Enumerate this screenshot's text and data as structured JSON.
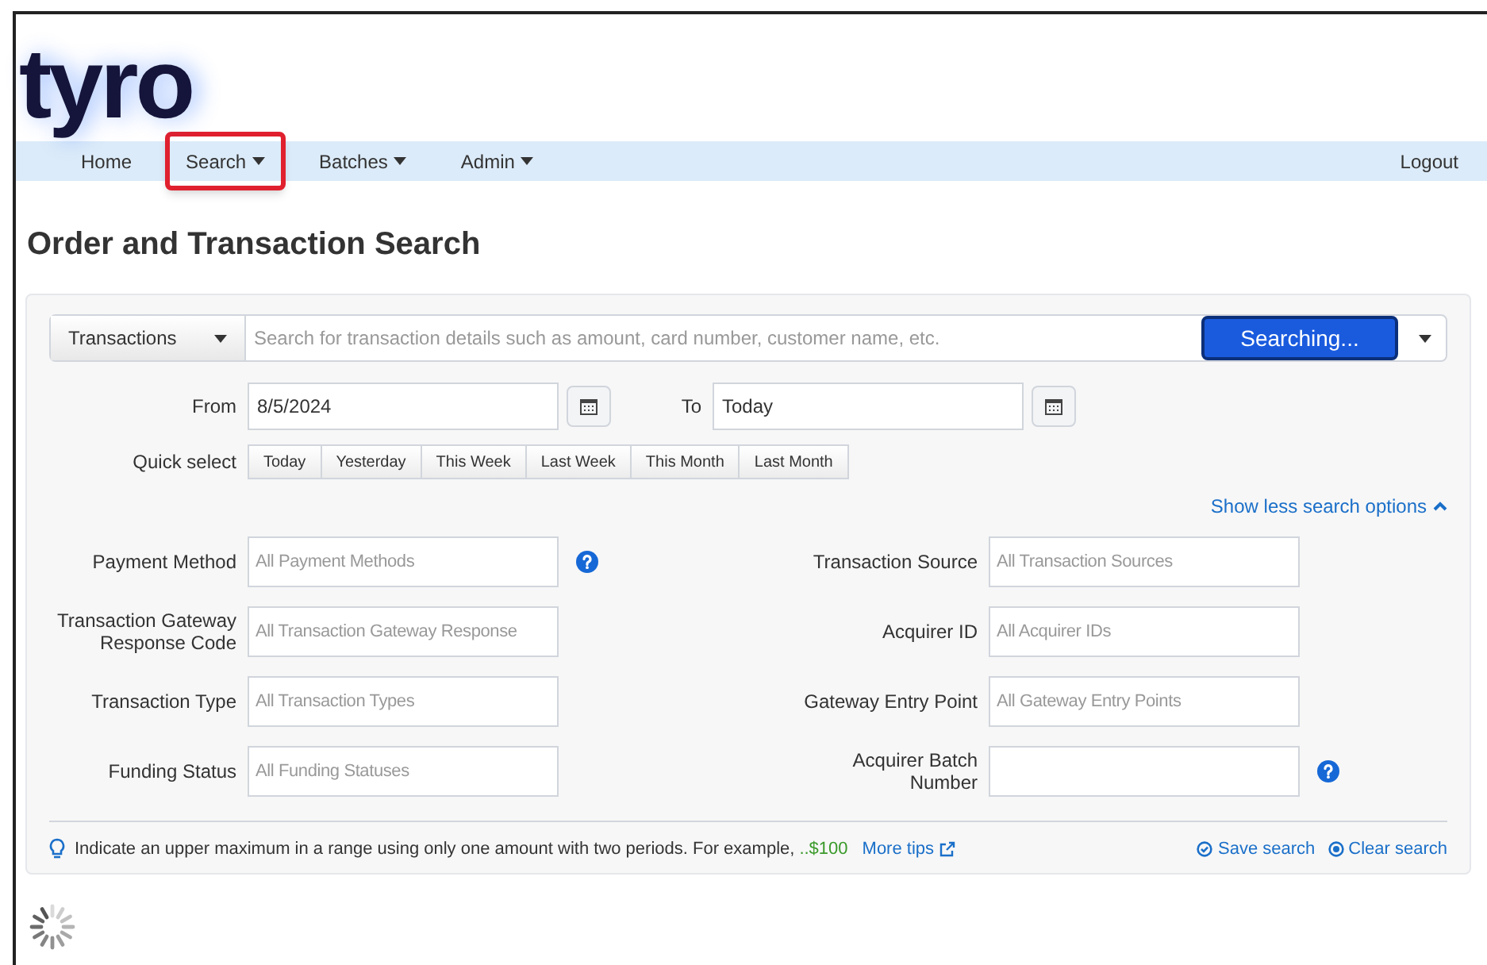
{
  "logo": {
    "text": "tyro"
  },
  "nav": {
    "items": [
      {
        "label": "Home",
        "dropdown": false,
        "highlighted": false
      },
      {
        "label": "Search",
        "dropdown": true,
        "highlighted": true
      },
      {
        "label": "Batches",
        "dropdown": true,
        "highlighted": false
      },
      {
        "label": "Admin",
        "dropdown": true,
        "highlighted": false
      }
    ],
    "logout": "Logout"
  },
  "page_title": "Order and Transaction Search",
  "search": {
    "type_select": "Transactions",
    "placeholder": "Search for transaction details such as amount, card number, customer name, etc.",
    "button": "Searching..."
  },
  "dates": {
    "from_label": "From",
    "from_value": "8/5/2024",
    "to_label": "To",
    "to_value": "Today"
  },
  "quick_select": {
    "label": "Quick select",
    "options": [
      "Today",
      "Yesterday",
      "This Week",
      "Last Week",
      "This Month",
      "Last Month"
    ]
  },
  "toggle_link": "Show less search options",
  "fields": [
    {
      "label": "Payment Method",
      "placeholder": "All Payment Methods",
      "help": true
    },
    {
      "label": "Transaction Source",
      "placeholder": "All Transaction Sources",
      "help": false
    },
    {
      "label": "Transaction Gateway Response Code",
      "placeholder": "All Transaction Gateway Response",
      "help": false
    },
    {
      "label": "Acquirer ID",
      "placeholder": "All Acquirer IDs",
      "help": false
    },
    {
      "label": "Transaction Type",
      "placeholder": "All Transaction Types",
      "help": false
    },
    {
      "label": "Gateway Entry Point",
      "placeholder": "All Gateway Entry Points",
      "help": false
    },
    {
      "label": "Funding Status",
      "placeholder": "All Funding Statuses",
      "help": false
    },
    {
      "label": "Acquirer Batch Number",
      "help": true
    }
  ],
  "tip": {
    "text": "Indicate an upper maximum in a range using only one amount with two periods. For example,",
    "example": "..$100",
    "link": "More tips"
  },
  "actions": [
    "Save search",
    "Clear search"
  ]
}
